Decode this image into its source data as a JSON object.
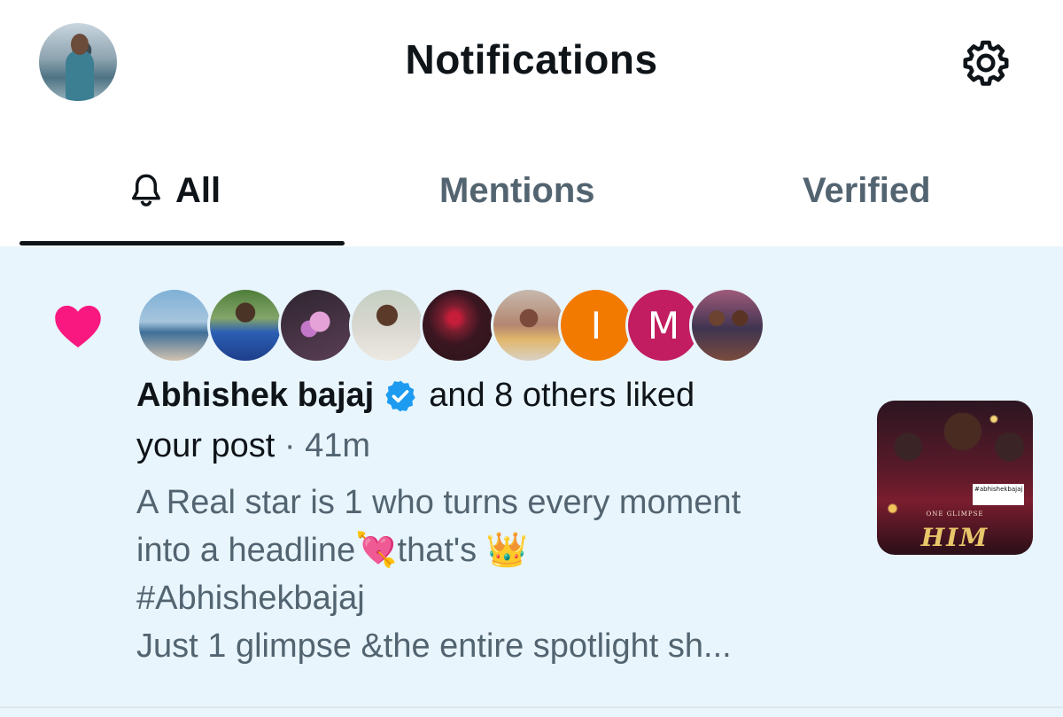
{
  "header": {
    "title": "Notifications",
    "profile_avatar": "user-avatar",
    "settings_icon": "gear-icon"
  },
  "tabs": [
    {
      "label": "All",
      "icon": "bell-icon",
      "active": true
    },
    {
      "label": "Mentions",
      "active": false
    },
    {
      "label": "Verified",
      "active": false
    }
  ],
  "notification": {
    "icon": "heart-icon",
    "icon_color": "#f91880",
    "background": "#e8f5fd",
    "avatars": [
      {
        "type": "photo"
      },
      {
        "type": "photo"
      },
      {
        "type": "photo"
      },
      {
        "type": "photo"
      },
      {
        "type": "photo"
      },
      {
        "type": "photo"
      },
      {
        "type": "letter",
        "letter": "I",
        "color": "#f27a00"
      },
      {
        "type": "letter",
        "letter": "M",
        "color": "#c21d60"
      },
      {
        "type": "photo"
      }
    ],
    "name": "Abhishek bajaj",
    "verified_badge_color": "#1d9bf0",
    "action": "and 8 others liked",
    "action_cont": "your post",
    "separator": " · ",
    "time": "41m",
    "post_lines": [
      "A Real star is 1 who turns every moment",
      "into a headline💘that's 👑",
      "#Abhishekbajaj",
      "Just 1 glimpse &the entire spotlight sh..."
    ],
    "thumbnail": {
      "tag": "#abhishekbajaj",
      "subtitle": "ONE GLIMPSE",
      "title": "HIM"
    }
  }
}
